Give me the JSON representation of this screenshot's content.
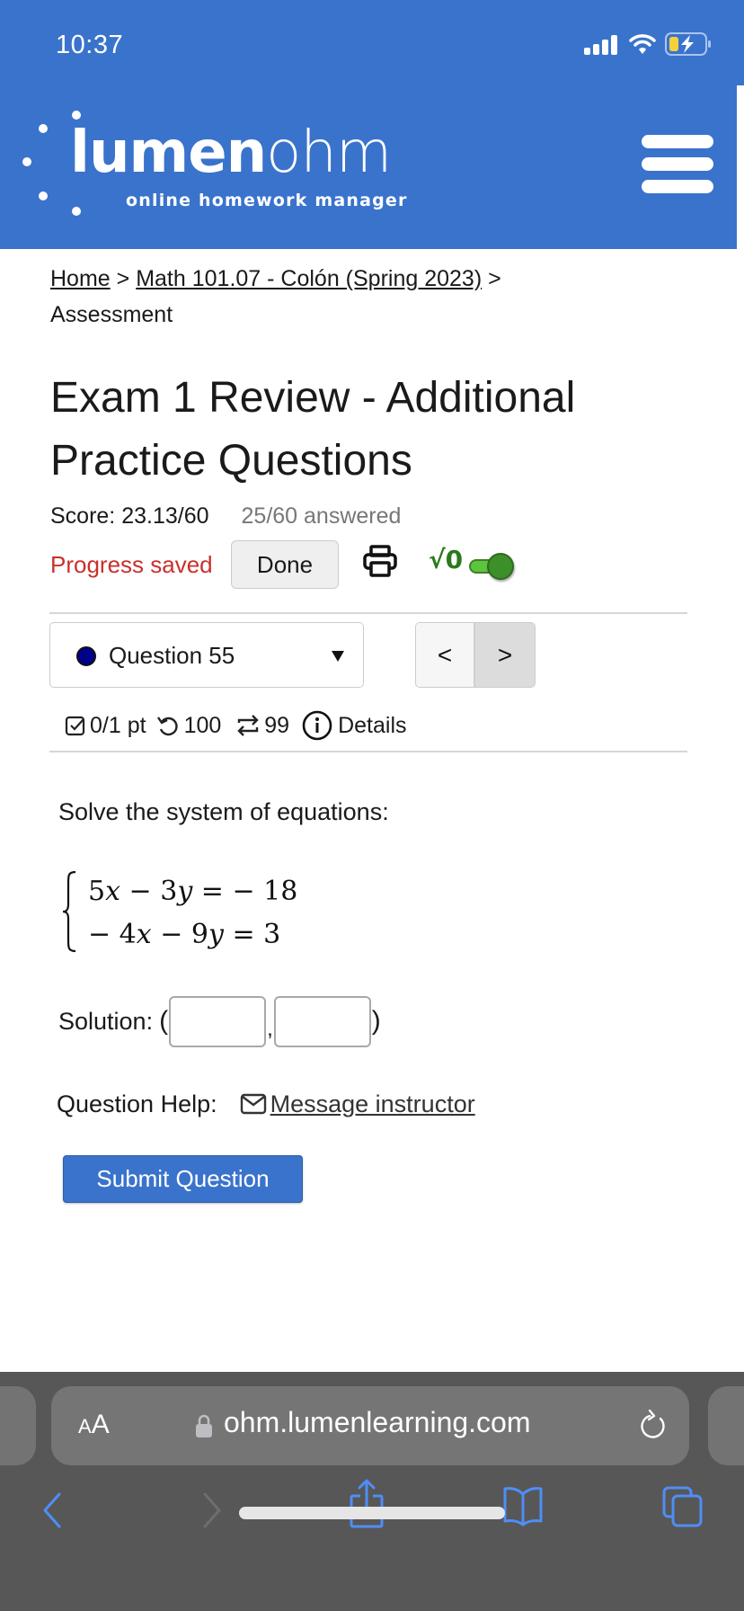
{
  "status_bar": {
    "time": "10:37",
    "icons": [
      "cellular-signal-icon",
      "wifi-icon",
      "battery-charging-icon"
    ]
  },
  "header": {
    "logo_primary": "lumen",
    "logo_secondary": "ohm",
    "tagline": "online homework manager",
    "menu_icon": "hamburger-menu-icon",
    "brand_color": "#3a73cc"
  },
  "breadcrumb": {
    "items": [
      {
        "label": "Home",
        "link": true
      },
      {
        "label": "Math 101.07 - Colón (Spring 2023)",
        "link": true
      },
      {
        "label": "Assessment",
        "link": false
      }
    ],
    "separator": ">"
  },
  "assessment": {
    "title": "Exam 1 Review - Additional Practice Questions",
    "score": "Score: 23.13/60",
    "answered": "25/60 answered",
    "progress_status": "Progress saved",
    "progress_color": "#c9302c",
    "done_label": "Done",
    "print_icon": "printer-icon",
    "math_toggle_label": "√0",
    "math_toggle_on": true
  },
  "question_nav": {
    "selected": "Question 55",
    "status_dot_color": "#00008b",
    "prev_label": "<",
    "next_label": ">"
  },
  "question_meta": {
    "points": "0/1 pt",
    "retries": "100",
    "versions": "99",
    "details_label": "Details"
  },
  "question": {
    "prompt": "Solve the system of equations:",
    "equations": [
      {
        "lhs": [
          "5",
          "x",
          " − 3",
          "y",
          " = "
        ],
        "rhs": "− 18"
      },
      {
        "lhs": [
          "− 4",
          "x",
          " − 9",
          "y",
          " = "
        ],
        "rhs": "3"
      }
    ],
    "solution_label": "Solution:",
    "solution_open": "(",
    "solution_sep": ",",
    "solution_close": ")",
    "inputs": [
      {
        "value": "",
        "placeholder": ""
      },
      {
        "value": "",
        "placeholder": ""
      }
    ],
    "help_label": "Question Help:",
    "message_link": "Message instructor",
    "submit_label": "Submit Question"
  },
  "browser": {
    "text_size_small": "A",
    "text_size_large": "A",
    "url": "ohm.lumenlearning.com",
    "accent_color": "#4e8ef7"
  }
}
